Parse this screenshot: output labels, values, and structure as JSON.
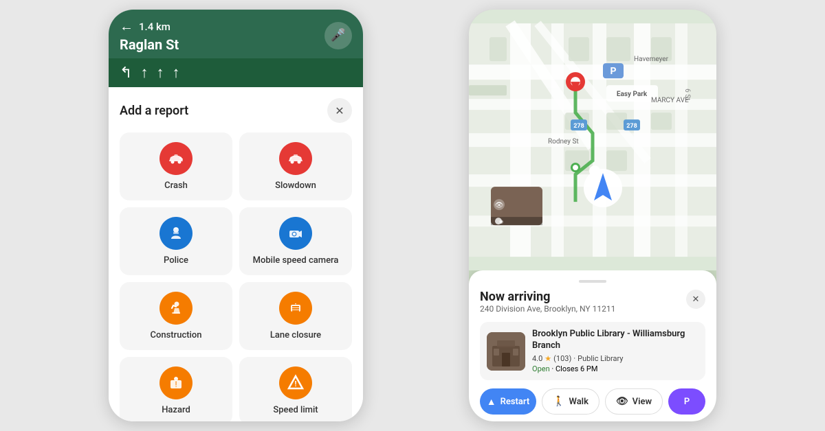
{
  "leftPhone": {
    "nav": {
      "distance": "1.4 km",
      "street": "Raglan St",
      "micIcon": "🎤"
    },
    "report": {
      "title": "Add a report",
      "closeIcon": "✕",
      "items": [
        {
          "id": "crash",
          "label": "Crash",
          "iconColor": "red",
          "icon": "🚗"
        },
        {
          "id": "slowdown",
          "label": "Slowdown",
          "iconColor": "red",
          "icon": "🚘"
        },
        {
          "id": "police",
          "label": "Police",
          "iconColor": "blue",
          "icon": "👮"
        },
        {
          "id": "mobile-speed-camera",
          "label": "Mobile speed camera",
          "iconColor": "blue",
          "icon": "📷"
        },
        {
          "id": "construction",
          "label": "Construction",
          "iconColor": "orange",
          "icon": "🚧"
        },
        {
          "id": "lane-closure",
          "label": "Lane closure",
          "iconColor": "orange",
          "icon": "🚦"
        },
        {
          "id": "hazard",
          "label": "Hazard",
          "iconColor": "orange",
          "icon": "⚠️"
        },
        {
          "id": "speed-limit",
          "label": "Speed limit",
          "iconColor": "orange",
          "icon": "🔺"
        }
      ]
    }
  },
  "rightPhone": {
    "arriving": {
      "title": "Now arriving",
      "address": "240 Division Ave, Brooklyn, NY 11211",
      "closeIcon": "✕",
      "destination": {
        "name": "Brooklyn Public Library - Williamsburg Branch",
        "rating": "4.0",
        "reviews": "103",
        "type": "Public Library",
        "status": "Open",
        "hours": "Closes 6 PM"
      },
      "actions": [
        {
          "id": "restart",
          "label": "Restart",
          "icon": "↑",
          "style": "blue"
        },
        {
          "id": "walk",
          "label": "Walk",
          "icon": "🚶",
          "style": "outline"
        },
        {
          "id": "view",
          "label": "View",
          "icon": "👁",
          "style": "outline"
        },
        {
          "id": "park",
          "label": "P",
          "icon": "",
          "style": "purple"
        }
      ]
    }
  }
}
